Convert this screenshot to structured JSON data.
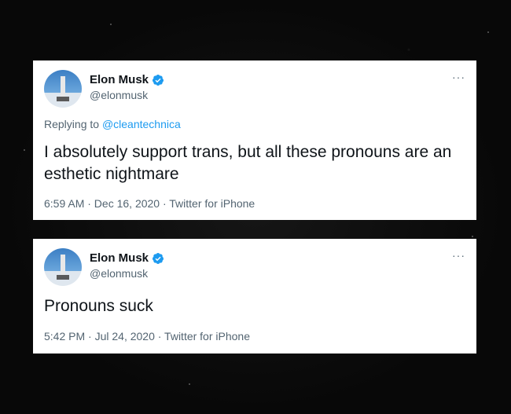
{
  "tweets": [
    {
      "name": "Elon Musk",
      "handle": "@elonmusk",
      "replying_prefix": "Replying to",
      "replying_to": "@cleantechnica",
      "text": "I absolutely support trans, but all these pronouns are an esthetic nightmare",
      "meta": "6:59 AM · Dec 16, 2020 · Twitter for iPhone",
      "more": "···",
      "avatar_icon": "rocket-launch-tower-avatar",
      "verified_icon": "verified-badge-icon"
    },
    {
      "name": "Elon Musk",
      "handle": "@elonmusk",
      "text": "Pronouns suck",
      "meta": "5:42 PM · Jul 24, 2020 · Twitter for iPhone",
      "more": "···",
      "avatar_icon": "rocket-launch-tower-avatar",
      "verified_icon": "verified-badge-icon"
    }
  ],
  "colors": {
    "verified": "#1d9bf0",
    "mention": "#1d9bf0",
    "secondary_text": "#536471",
    "primary_text": "#0f1419",
    "card": "#ffffff",
    "background": "#0a0a0a"
  }
}
